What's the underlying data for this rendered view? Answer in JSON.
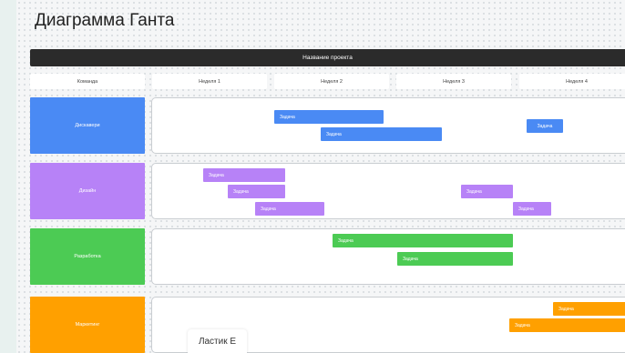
{
  "title": "Диаграмма Ганта",
  "project_label": "Название проекта",
  "headers": [
    "Команда",
    "Неделя 1",
    "Неделя 2",
    "Неделя 3",
    "Неделя 4"
  ],
  "teams": [
    {
      "name": "Дискавери",
      "color": "#4a8af4"
    },
    {
      "name": "Дизайн",
      "color": "#b782f7"
    },
    {
      "name": "Разработка",
      "color": "#4ccb54"
    },
    {
      "name": "Маркетинг",
      "color": "#ffa000"
    }
  ],
  "task_label": "Задача",
  "tooltip": "Ластик E"
}
